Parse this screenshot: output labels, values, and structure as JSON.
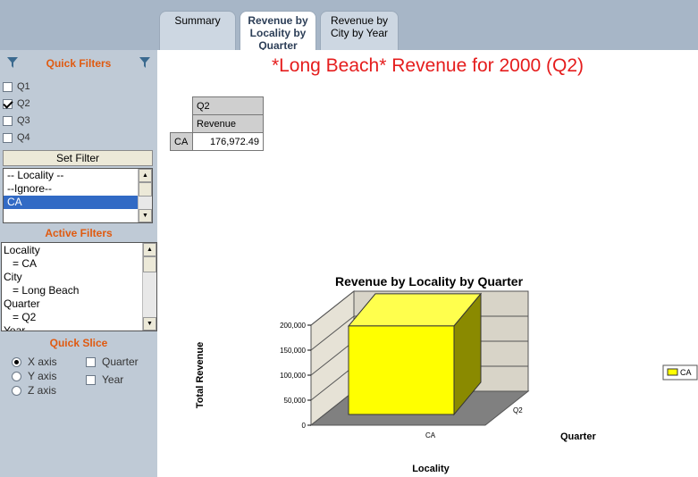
{
  "tabs": [
    {
      "label": "Summary"
    },
    {
      "label": "Revenue by Locality by Quarter"
    },
    {
      "label": "Revenue by City by Year"
    }
  ],
  "sidebar": {
    "quick_filters_title": "Quick Filters",
    "quarters": [
      {
        "label": "Q1",
        "checked": false
      },
      {
        "label": "Q2",
        "checked": true
      },
      {
        "label": "Q3",
        "checked": false
      },
      {
        "label": "Q4",
        "checked": false
      }
    ],
    "set_filter_label": "Set Filter",
    "locality_options": [
      "-- Locality --",
      "--Ignore--",
      "CA"
    ],
    "locality_selected": "CA",
    "active_filters_title": "Active Filters",
    "active_filters": [
      "Locality",
      "   = CA",
      "City",
      "   = Long Beach",
      "Quarter",
      "   = Q2",
      "Year"
    ],
    "quick_slice_title": "Quick Slice",
    "axes": [
      {
        "label": "X axis",
        "selected": true
      },
      {
        "label": "Y axis",
        "selected": false
      },
      {
        "label": "Z axis",
        "selected": false
      }
    ],
    "slice_fields": [
      {
        "label": "Quarter",
        "checked": false
      },
      {
        "label": "Year",
        "checked": false
      }
    ]
  },
  "main": {
    "title": "*Long Beach* Revenue for 2000 (Q2)",
    "table": {
      "col_header": "Q2",
      "measure": "Revenue",
      "row_label": "CA",
      "value": "176,972.49"
    }
  },
  "colors": {
    "accent": "#e05a10",
    "title_red": "#e51d1d",
    "bar_yellow": "#ffff00",
    "selection": "#316ac5"
  },
  "chart_data": {
    "type": "bar",
    "title": "Revenue by Locality by Quarter",
    "xlabel": "Locality",
    "ylabel": "Total Revenue",
    "zlabel": "Quarter",
    "categories": [
      "CA"
    ],
    "z_categories": [
      "Q2"
    ],
    "series": [
      {
        "name": "CA",
        "values": [
          176972.49
        ]
      }
    ],
    "ylim": [
      0,
      200000
    ],
    "ticks": [
      "0",
      "50,000",
      "100,000",
      "150,000",
      "200,000"
    ],
    "legend_position": "right"
  }
}
